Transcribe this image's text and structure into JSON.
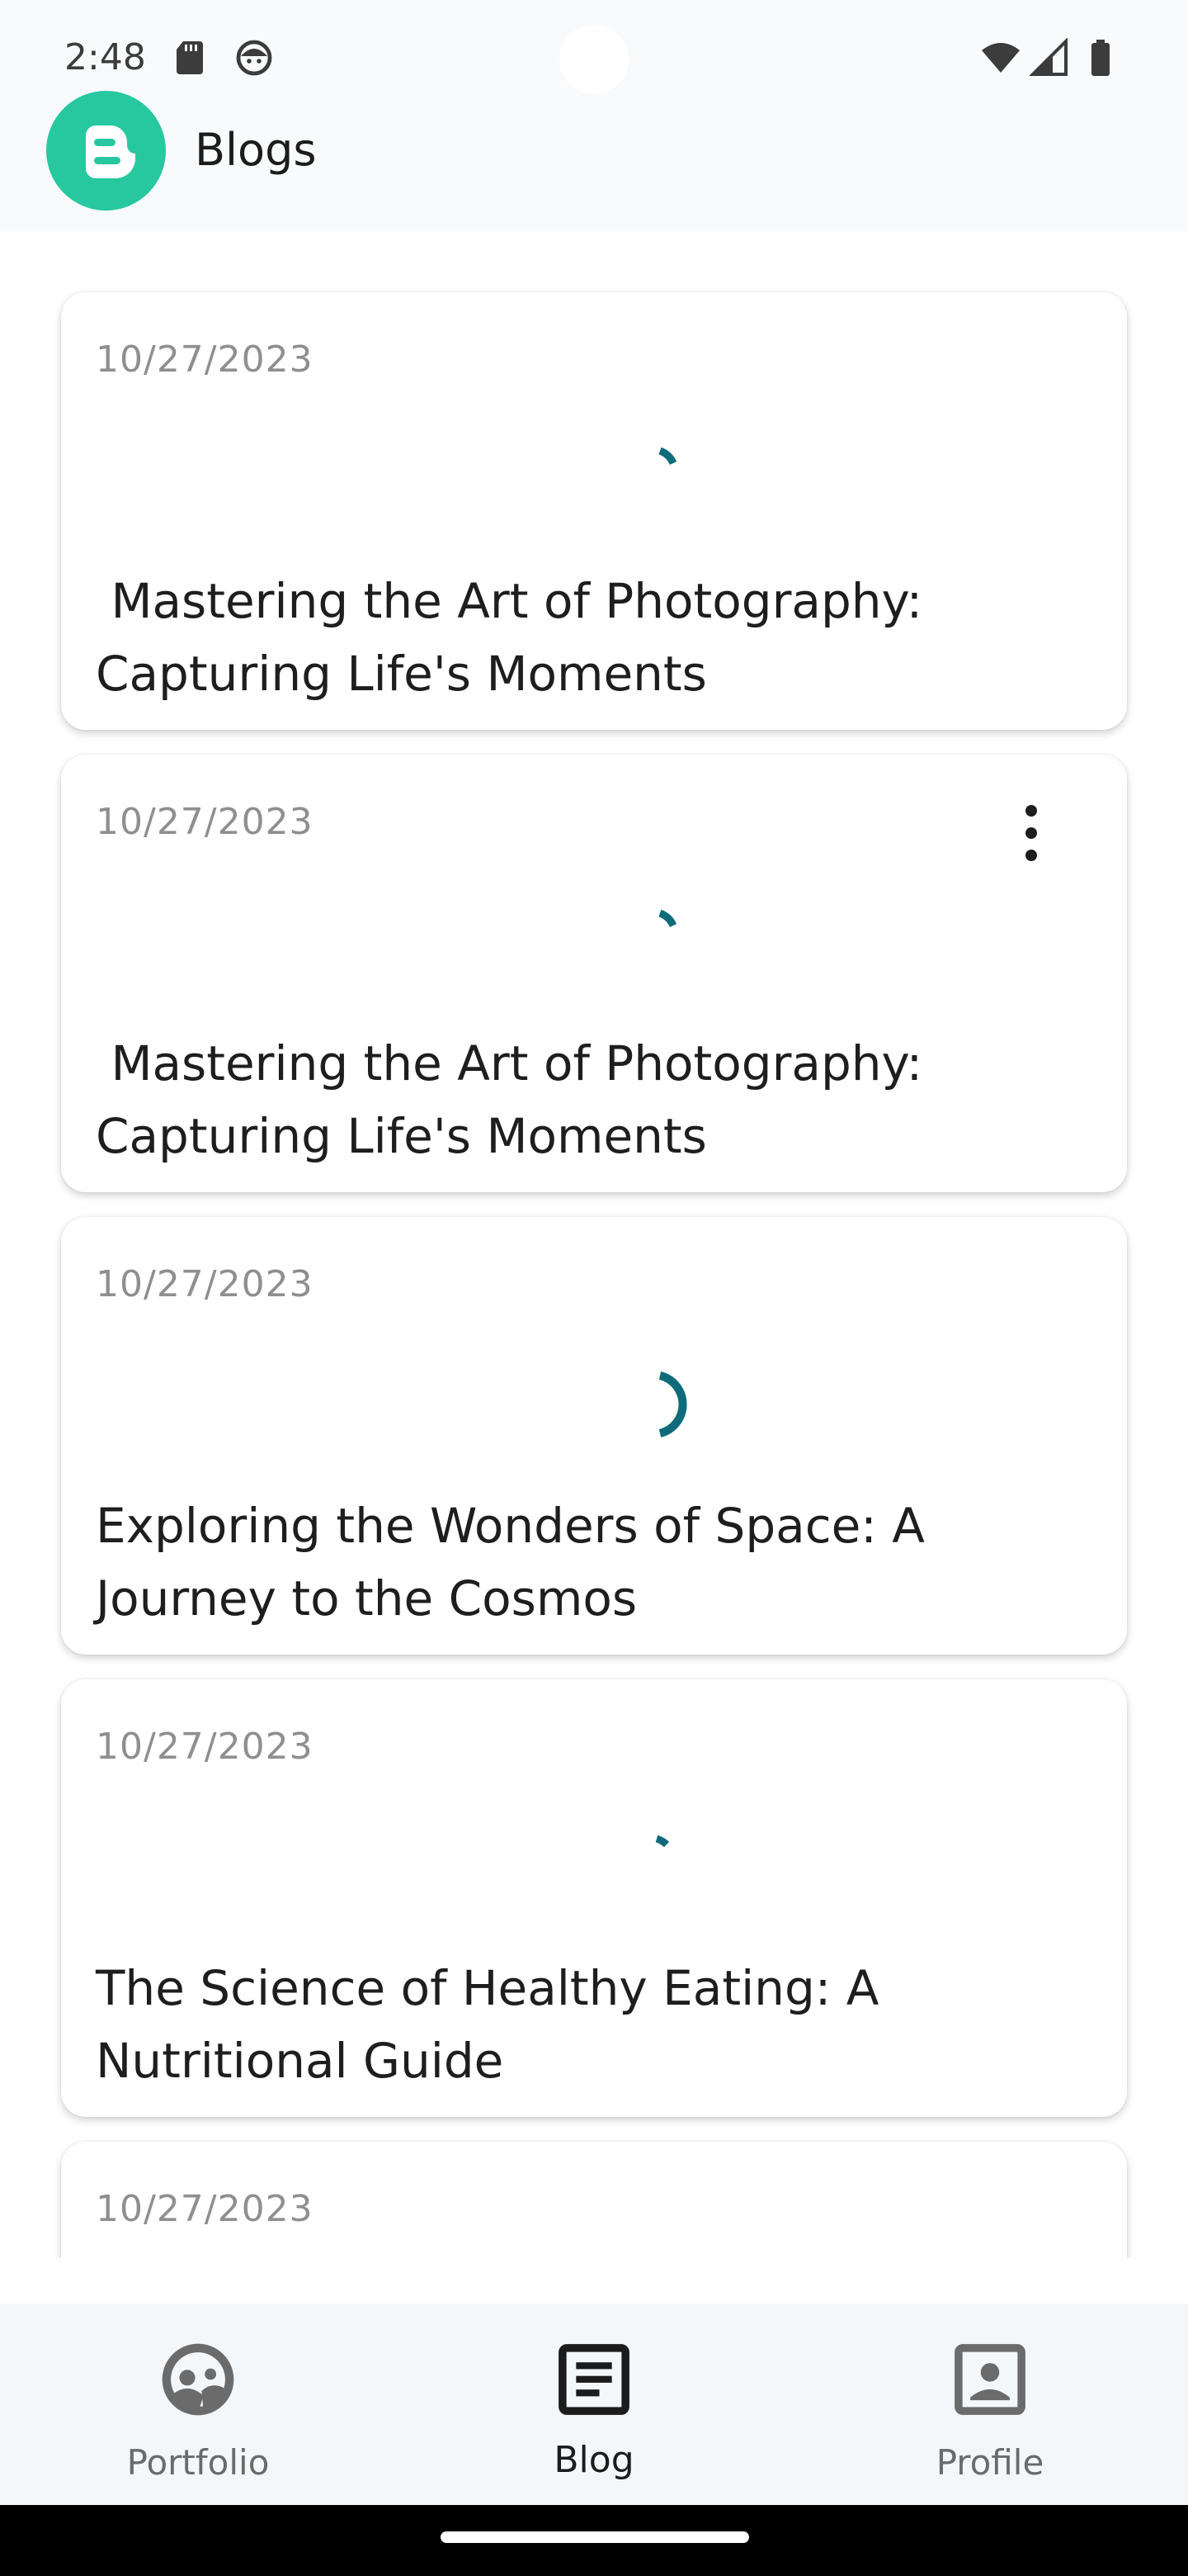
{
  "status_bar": {
    "time": "2:48",
    "icons": [
      "sd-card-icon",
      "android-face-icon",
      "wifi-icon",
      "signal-icon",
      "battery-icon"
    ]
  },
  "app_bar": {
    "title": "Blogs",
    "logo_icon": "blogger-logo-icon",
    "logo_color": "#27c8a0"
  },
  "posts": [
    {
      "date": "10/27/2023",
      "title": " Mastering the Art of Photography: Capturing Life's Moments",
      "has_menu": false
    },
    {
      "date": "10/27/2023",
      "title": " Mastering the Art of Photography: Capturing Life's Moments",
      "has_menu": true
    },
    {
      "date": "10/27/2023",
      "title": "Exploring the Wonders of Space: A Journey to the Cosmos",
      "has_menu": false
    },
    {
      "date": "10/27/2023",
      "title": "The Science of Healthy Eating: A Nutritional Guide",
      "has_menu": false
    },
    {
      "date": "10/27/2023",
      "title": "",
      "has_menu": false
    }
  ],
  "spinner_color": "#0e6b7a",
  "bottom_nav": {
    "items": [
      {
        "label": "Portfolio",
        "icon": "portfolio-face-icon",
        "active": false
      },
      {
        "label": "Blog",
        "icon": "article-icon",
        "active": true
      },
      {
        "label": "Profile",
        "icon": "profile-card-icon",
        "active": false
      }
    ]
  }
}
